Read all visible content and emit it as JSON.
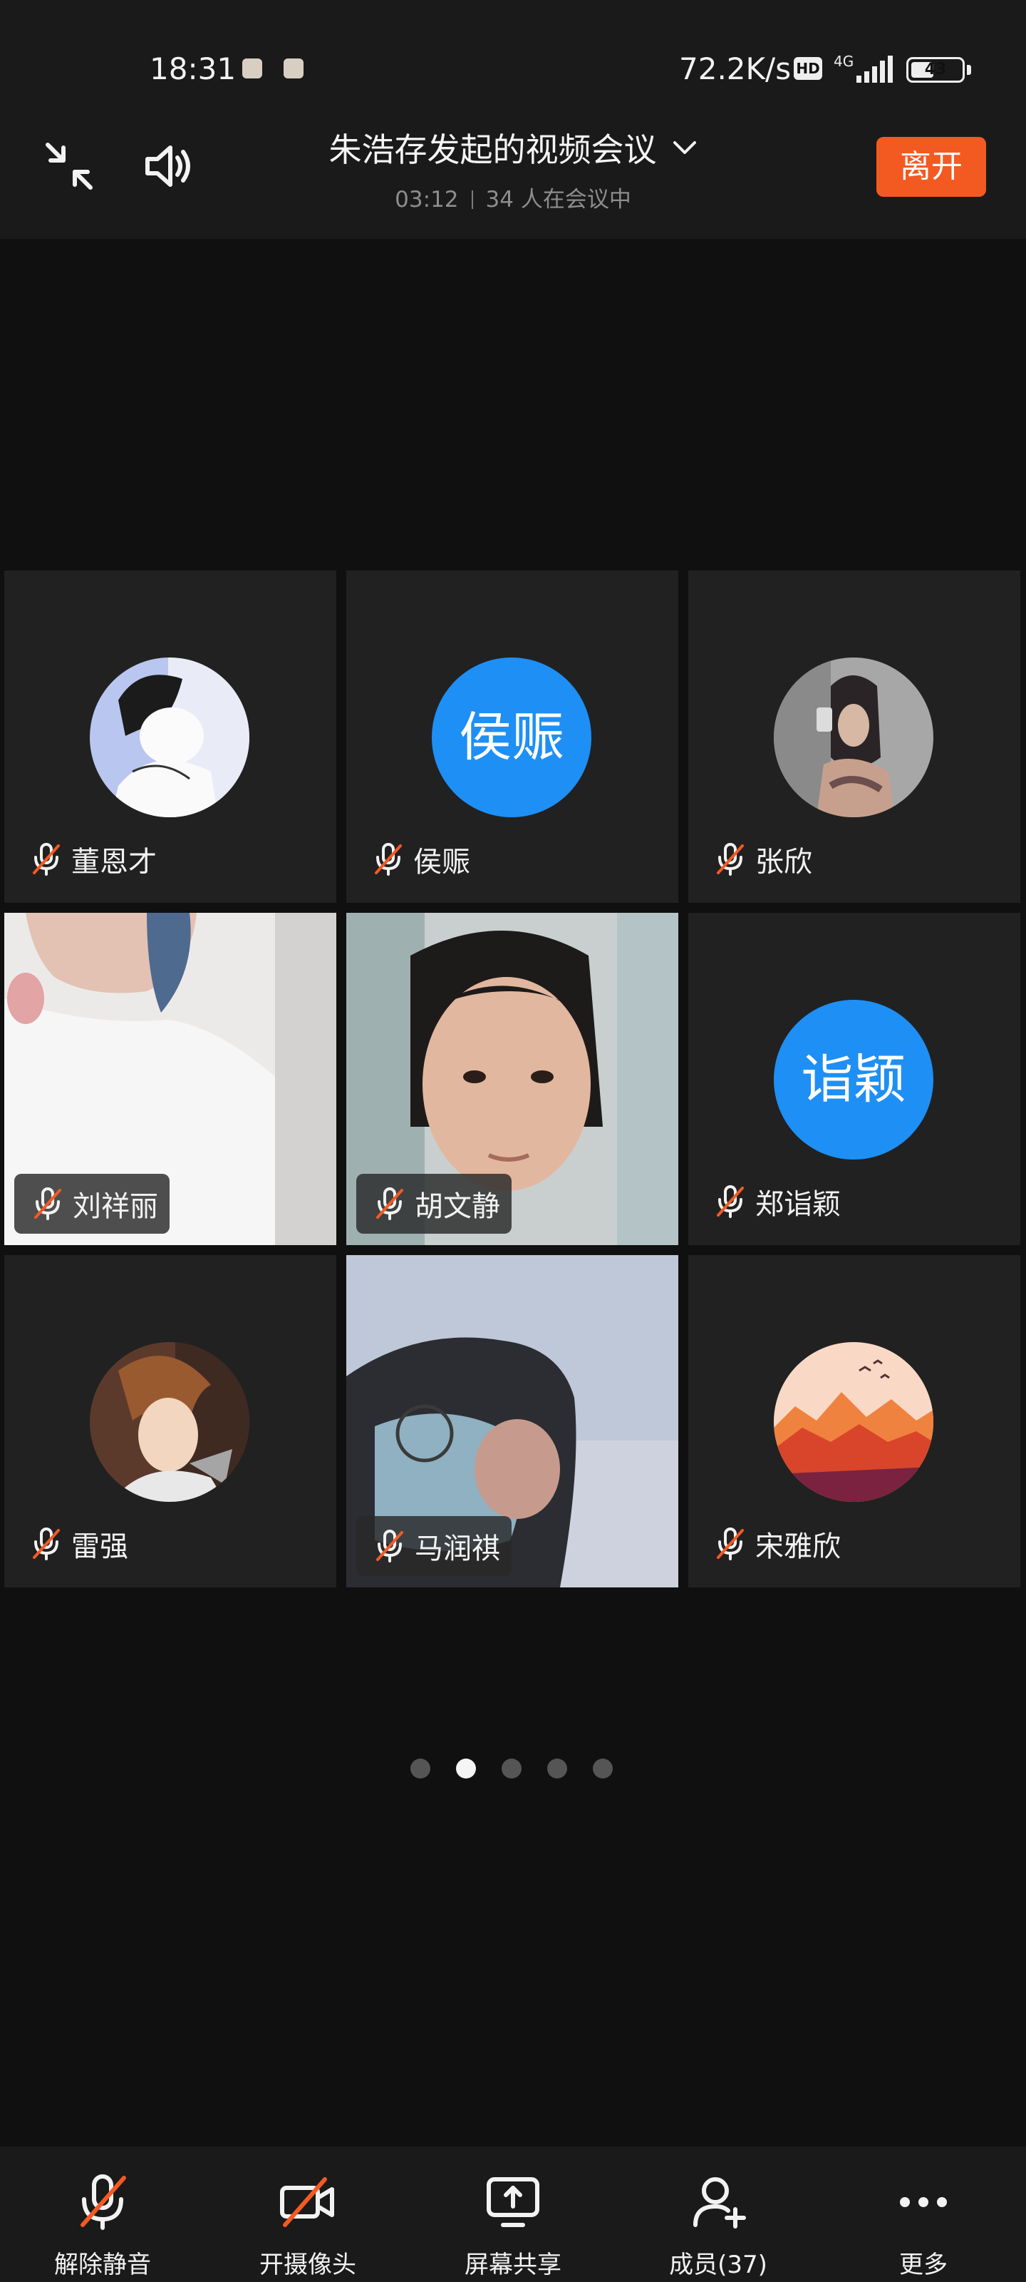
{
  "status_bar": {
    "time": "18:31",
    "speed": "72.2K/s",
    "hd": "HD",
    "network": "4G",
    "battery": "43"
  },
  "header": {
    "title": "朱浩存发起的视频会议",
    "duration": "03:12",
    "participants_text": "34 人在会议中",
    "leave_label": "离开"
  },
  "participants": [
    {
      "name": "董恩才",
      "muted": true,
      "display": "avatar-image"
    },
    {
      "name": "侯赈",
      "muted": true,
      "display": "avatar-text",
      "avatar_text": "侯赈"
    },
    {
      "name": "张欣",
      "muted": true,
      "display": "avatar-image"
    },
    {
      "name": "刘祥丽",
      "muted": true,
      "display": "video"
    },
    {
      "name": "胡文静",
      "muted": true,
      "display": "video"
    },
    {
      "name": "郑诣颖",
      "muted": true,
      "display": "avatar-text",
      "avatar_text": "诣颖"
    },
    {
      "name": "雷强",
      "muted": true,
      "display": "avatar-image"
    },
    {
      "name": "马润祺",
      "muted": true,
      "display": "video"
    },
    {
      "name": "宋雅欣",
      "muted": true,
      "display": "avatar-image"
    }
  ],
  "pagination": {
    "total": 5,
    "current": 2
  },
  "toolbar": {
    "unmute_label": "解除静音",
    "camera_label": "开摄像头",
    "share_label": "屏幕共享",
    "members_label": "成员(37)",
    "more_label": "更多"
  },
  "colors": {
    "leave": "#f35a22",
    "avatar_blue": "#1e8ff5",
    "mute_slash": "#f35a22"
  }
}
